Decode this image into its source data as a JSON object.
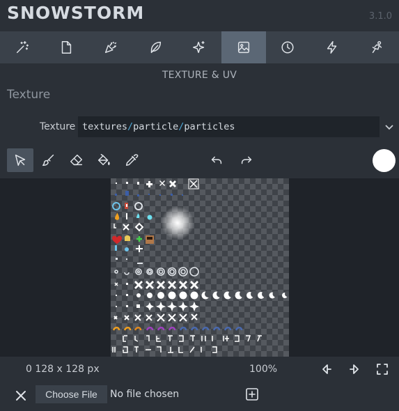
{
  "app": {
    "title": "SNOWSTORM",
    "version": "3.1.0"
  },
  "tabs": [
    {
      "icon": "magic-wand-icon",
      "active": false
    },
    {
      "icon": "file-icon",
      "active": false
    },
    {
      "icon": "party-popper-icon",
      "active": false
    },
    {
      "icon": "feather-icon",
      "active": false
    },
    {
      "icon": "sparkles-icon",
      "active": false
    },
    {
      "icon": "image-icon",
      "active": true
    },
    {
      "icon": "clock-icon",
      "active": false
    },
    {
      "icon": "lightning-icon",
      "active": false
    },
    {
      "icon": "motion-icon",
      "active": false
    }
  ],
  "section": {
    "title": "TEXTURE & UV",
    "group": "Texture"
  },
  "texture_field": {
    "label": "Texture",
    "segments": [
      "textures",
      "/",
      "particle",
      "/",
      "particles"
    ]
  },
  "tools": [
    {
      "icon": "pointer-icon",
      "active": true
    },
    {
      "icon": "brush-icon",
      "active": false
    },
    {
      "icon": "eraser-icon",
      "active": false
    },
    {
      "icon": "fill-bucket-icon",
      "active": false
    },
    {
      "icon": "eyedropper-icon",
      "active": false
    },
    {
      "icon": "undo-icon",
      "active": false
    },
    {
      "icon": "redo-icon",
      "active": false
    }
  ],
  "color": {
    "current": "#ffffff"
  },
  "status": {
    "size": "0 128 x 128 px",
    "zoom": "100%"
  },
  "file": {
    "choose_label": "Choose File",
    "status": "No file chosen"
  },
  "colors": {
    "accent": "#5b6775",
    "path_slash": "#4ea7d6",
    "background": "#2b3037",
    "tabbar": "#3a414a"
  }
}
